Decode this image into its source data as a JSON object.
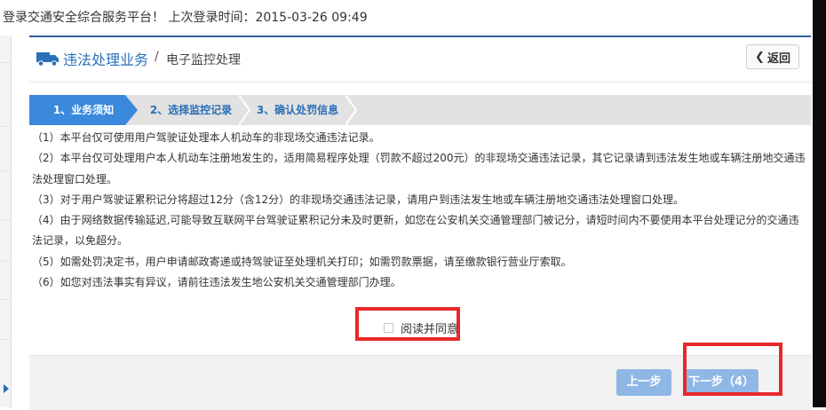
{
  "topbar": {
    "text": "登录交通安全综合服务平台！  上次登录时间：2015-03-26 09:49"
  },
  "header": {
    "icon": "truck-icon",
    "title": "违法处理业务",
    "separator": "/",
    "subtitle": "电子监控处理",
    "back_label": "返回"
  },
  "steps": [
    {
      "label": "1、业务须知",
      "active": true
    },
    {
      "label": "2、选择监控记录",
      "active": false
    },
    {
      "label": "3、确认处罚信息",
      "active": false
    }
  ],
  "notices": [
    "（1）本平台仅可使用用户驾驶证处理本人机动车的非现场交通违法记录。",
    "（2）本平台仅可处理用户本人机动车注册地发生的，适用简易程序处理（罚款不超过200元）的非现场交通违法记录，其它记录请到违法发生地或车辆注册地交通违法处理窗口处理。",
    "（3）对于用户驾驶证累积记分将超过12分（含12分）的非现场交通违法记录，请用户到违法发生地或车辆注册地交通违法处理窗口处理。",
    "（4）由于网络数据传输延迟,可能导致互联网平台驾驶证累积记分未及时更新，如您在公安机关交通管理部门被记分，请短时间内不要使用本平台处理记分的交通违法记录，以免超分。",
    "（5）如需处罚决定书，用户申请邮政寄递或持驾驶证至处理机关打印；如需罚款票据，请至缴款银行营业厅索取。",
    "（6）如您对违法事实有异议，请前往违法发生地公安机关交通管理部门办理。"
  ],
  "agree": {
    "label": "阅读并同意",
    "checked": false
  },
  "footer": {
    "prev_label": "上一步",
    "next_label": "下一步（4）"
  },
  "colors": {
    "accent": "#2a6fb8",
    "step_active": "#3a89dc",
    "button_disabled": "#8fb7e6",
    "highlight": "#e8282b"
  }
}
